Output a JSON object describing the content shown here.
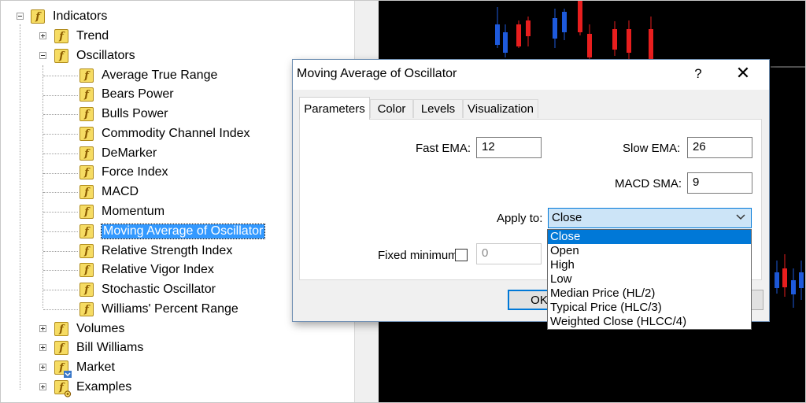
{
  "navigator": {
    "root": "Indicators",
    "items": [
      {
        "label": "Trend"
      },
      {
        "label": "Oscillators"
      },
      {
        "label": "Average True Range"
      },
      {
        "label": "Bears Power"
      },
      {
        "label": "Bulls Power"
      },
      {
        "label": "Commodity Channel Index"
      },
      {
        "label": "DeMarker"
      },
      {
        "label": "Force Index"
      },
      {
        "label": "MACD"
      },
      {
        "label": "Momentum"
      },
      {
        "label": "Moving Average of Oscillator"
      },
      {
        "label": "Relative Strength Index"
      },
      {
        "label": "Relative Vigor Index"
      },
      {
        "label": "Stochastic Oscillator"
      },
      {
        "label": "Williams' Percent Range"
      },
      {
        "label": "Volumes"
      },
      {
        "label": "Bill Williams"
      },
      {
        "label": "Market"
      },
      {
        "label": "Examples"
      }
    ],
    "icon_glyph": "f"
  },
  "dialog": {
    "title": "Moving Average of Oscillator",
    "help": "?",
    "close": "✕",
    "tabs": [
      "Parameters",
      "Color",
      "Levels",
      "Visualization"
    ],
    "fast_ema_label": "Fast EMA:",
    "fast_ema_value": "12",
    "slow_ema_label": "Slow EMA:",
    "slow_ema_value": "26",
    "macd_sma_label": "MACD SMA:",
    "macd_sma_value": "9",
    "apply_to_label": "Apply to:",
    "apply_to_value": "Close",
    "fixed_minimum_label": "Fixed minimum",
    "fixed_minimum_value": "0",
    "ok_label": "OK",
    "apply_options": [
      "Close",
      "Open",
      "High",
      "Low",
      "Median Price (HL/2)",
      "Typical Price (HLC/3)",
      "Weighted Close (HLCC/4)"
    ]
  },
  "colors": {
    "bull_candle": "#1e5adc",
    "bear_candle": "#e81e1e",
    "chart_bg": "#000000",
    "selection": "#3399ff",
    "accent": "#0078d7"
  }
}
